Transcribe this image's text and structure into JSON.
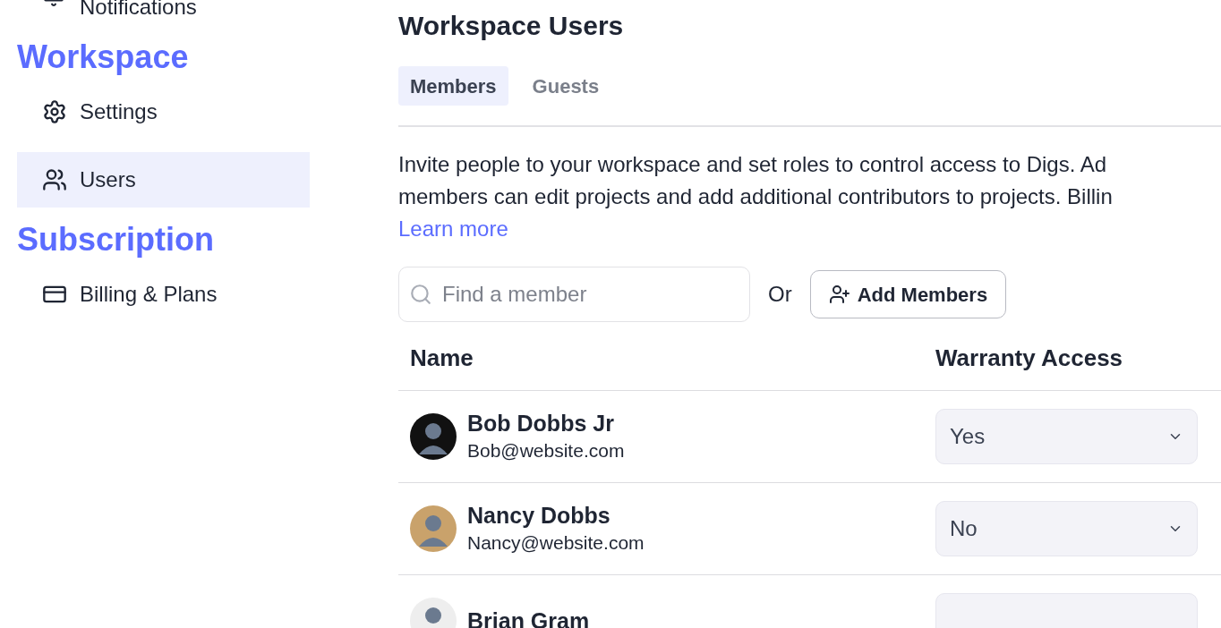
{
  "sidebar": {
    "cut_item": {
      "label": "Notifications"
    },
    "sections": [
      {
        "title": "Workspace",
        "items": [
          {
            "label": "Settings",
            "selected": false
          },
          {
            "label": "Users",
            "selected": true
          }
        ]
      },
      {
        "title": "Subscription",
        "items": [
          {
            "label": "Billing & Plans",
            "selected": false
          }
        ]
      }
    ]
  },
  "main": {
    "title": "Workspace Users",
    "tabs": [
      {
        "label": "Members",
        "selected": true
      },
      {
        "label": "Guests",
        "selected": false
      }
    ],
    "intro_lines": [
      "Invite people to your workspace and set roles to control access to Digs. Ad",
      "members can edit projects and add additional contributors to projects. Billin"
    ],
    "learn_more": "Learn more",
    "search": {
      "placeholder": "Find a member"
    },
    "or_text": "Or",
    "add_button": "Add Members",
    "table": {
      "columns": [
        "Name",
        "Warranty Access"
      ],
      "rows": [
        {
          "name": "Bob Dobbs Jr",
          "email": "Bob@website.com",
          "access": "Yes"
        },
        {
          "name": "Nancy Dobbs",
          "email": "Nancy@website.com",
          "access": "No"
        },
        {
          "name": "Brian Gram"
        }
      ]
    }
  }
}
